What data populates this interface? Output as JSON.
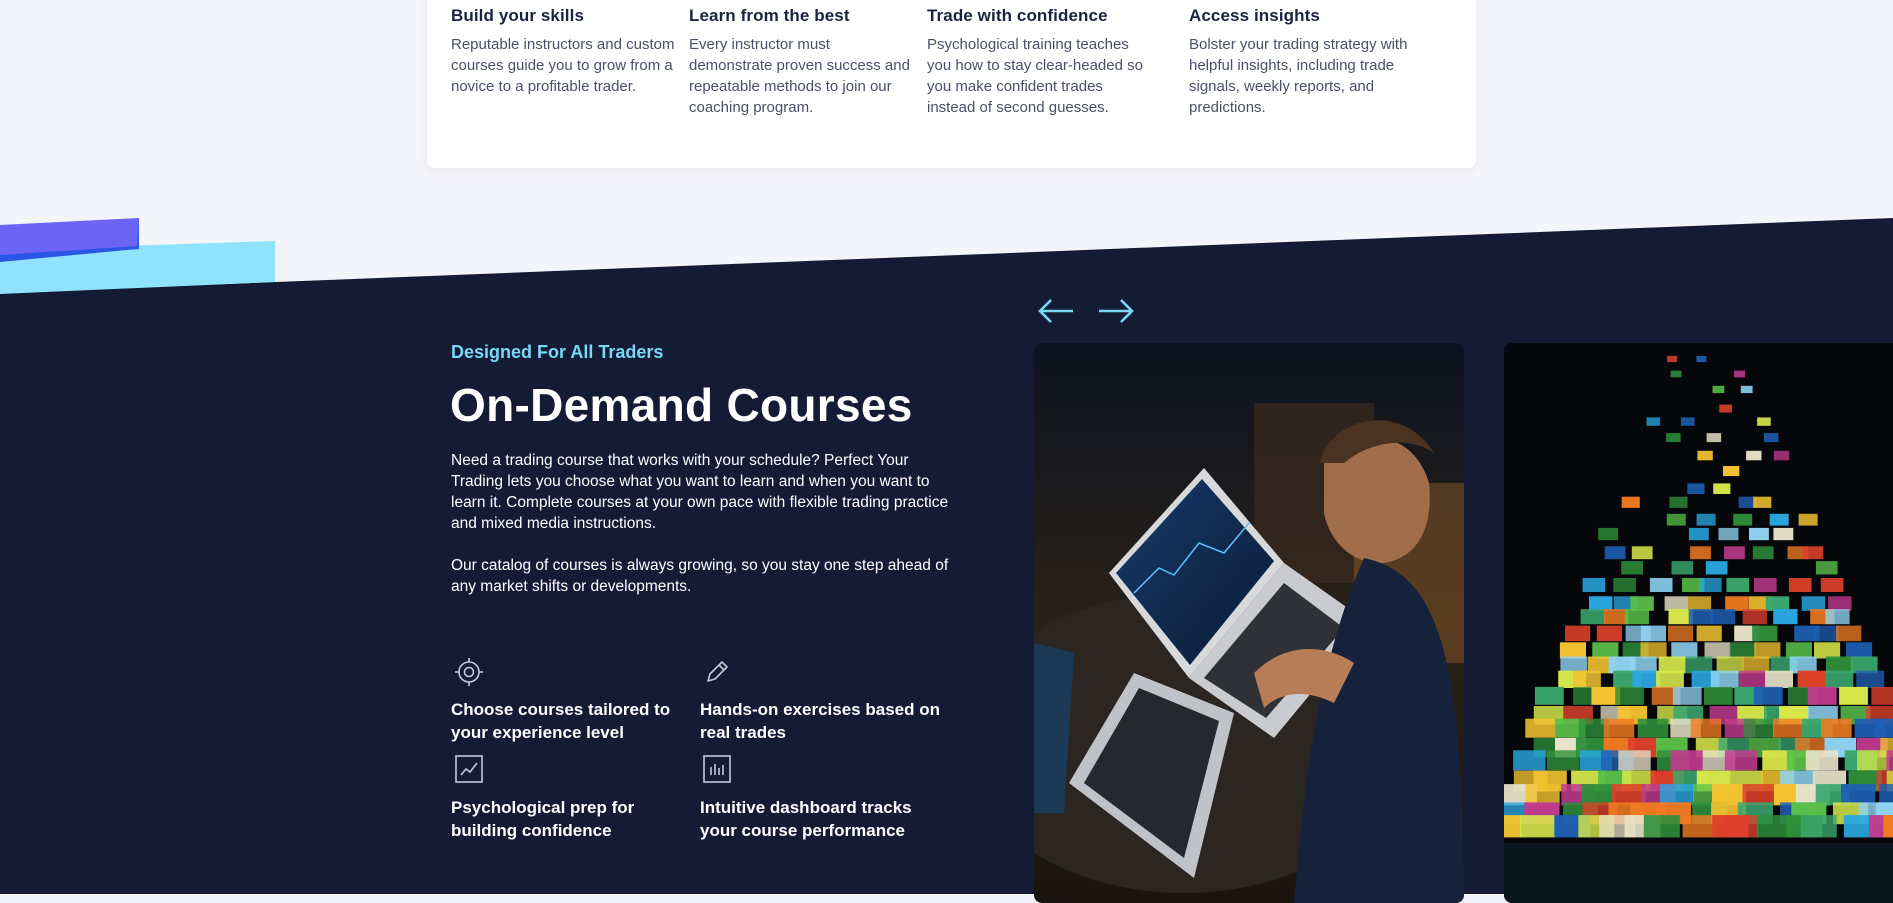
{
  "features": [
    {
      "icon": "circle-icon",
      "title": "Build your skills",
      "text": "Reputable instructors and custom courses guide you to grow from a novice to a profitable trader."
    },
    {
      "icon": "pin-icon",
      "title": "Learn from the best",
      "text": "Every instructor must demonstrate proven success and repeatable methods to join our coaching program."
    },
    {
      "icon": "card-icon",
      "title": "Trade with confidence",
      "text": "Psychological training teaches you how to stay clear-headed so you make confident trades instead of second guesses."
    },
    {
      "icon": "card-icon",
      "title": "Access insights",
      "text": "Bolster your trading strategy with helpful insights, including trade signals, weekly reports, and predictions."
    }
  ],
  "courses": {
    "eyebrow": "Designed For All Traders",
    "title": "On-Demand Courses",
    "paragraphs": [
      "Need a trading course that works with your schedule? Perfect Your Trading lets you choose what you want to learn and when you want to learn it. Complete courses at your own pace with flexible trading practice and mixed media instructions.",
      "Our catalog of courses is always growing, so you stay one step ahead of any market shifts or developments."
    ],
    "benefits": [
      {
        "icon": "target-icon",
        "label": "Choose courses tailored to your experience level"
      },
      {
        "icon": "pencil-icon",
        "label": "Hands-on exercises based on real trades"
      },
      {
        "icon": "line-chart-icon",
        "label": "Psychological prep for building confidence"
      },
      {
        "icon": "bar-chart-icon",
        "label": "Intuitive dashboard tracks your course performance"
      }
    ]
  },
  "carousel": {
    "prev_icon": "arrow-left-icon",
    "next_icon": "arrow-right-icon",
    "slides": [
      "trader-laptop-photo",
      "video-wall-photo"
    ]
  },
  "colors": {
    "navy": "#141c35",
    "accent_cyan": "#7ad8f6",
    "accent_purple": "#6c63f7",
    "accent_blue": "#2b55e6",
    "light_bg": "#f4f5fa"
  }
}
